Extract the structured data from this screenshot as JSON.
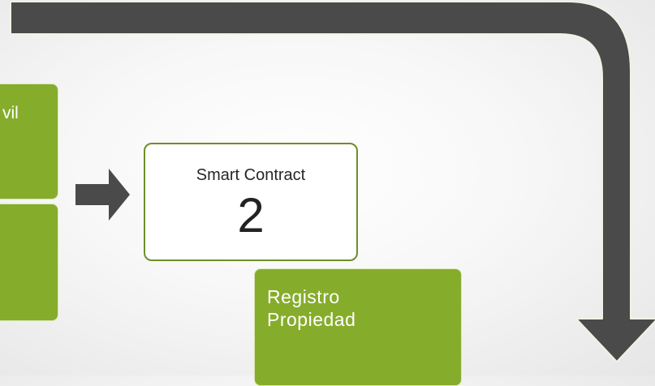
{
  "diagram": {
    "boxes": {
      "left_top": {
        "text": "vil"
      },
      "left_bottom": {
        "text": ""
      },
      "smart_contract": {
        "title": "Smart Contract",
        "number": "2"
      },
      "registro": {
        "line1": "Registro",
        "line2": "Propiedad"
      }
    },
    "colors": {
      "green": "#86ac2c",
      "green_border": "#6e8e2a",
      "arrow": "#4a4a4a",
      "background": "#f4f4f4"
    }
  }
}
